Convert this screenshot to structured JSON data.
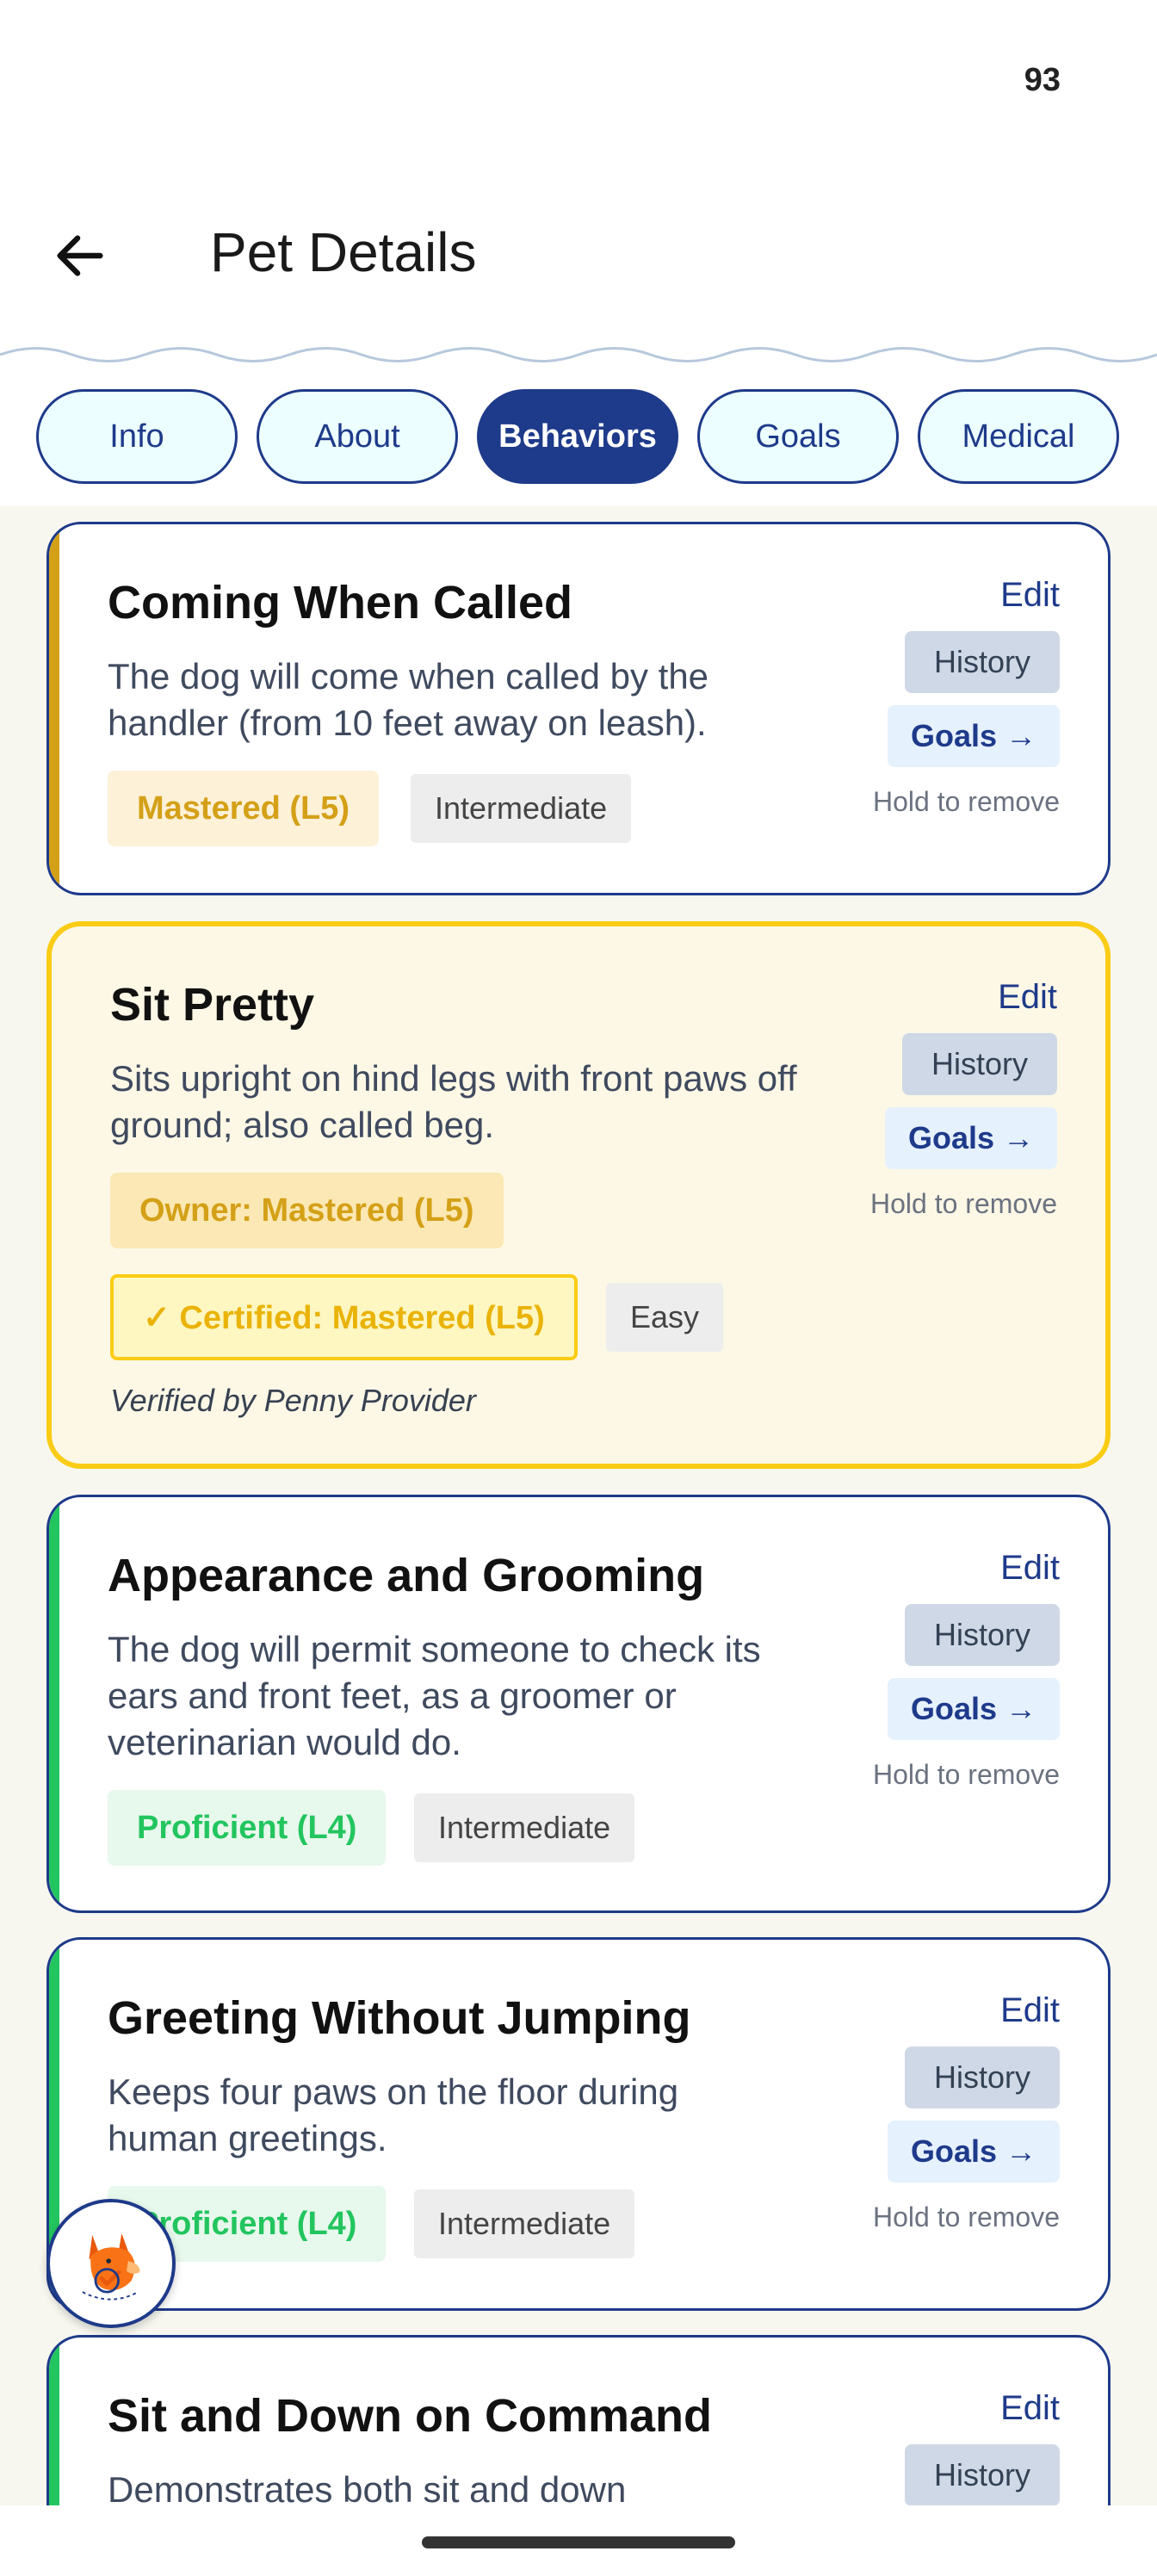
{
  "status": {
    "battery": "93"
  },
  "appbar": {
    "title": "Pet Details"
  },
  "tabs": [
    {
      "label": "Info"
    },
    {
      "label": "About"
    },
    {
      "label": "Behaviors"
    },
    {
      "label": "Goals"
    },
    {
      "label": "Medical"
    }
  ],
  "active_tab": "Behaviors",
  "actions": {
    "edit": "Edit",
    "history": "History",
    "goals": "Goals →",
    "hold": "Hold to remove"
  },
  "cards": [
    {
      "title": "Coming When Called",
      "description": "The dog will come when called by the handler (from 10 feet away on leash).",
      "status": "Mastered (L5)",
      "difficulty": "Intermediate",
      "accent_color": "#d4a017"
    },
    {
      "title": "Sit Pretty",
      "description": "Sits upright on hind legs with front paws off ground; also called beg.",
      "owner_status": "Owner: Mastered (L5)",
      "certified_status": "✓ Certified: Mastered (L5)",
      "difficulty": "Easy",
      "verified": "Verified by Penny Provider",
      "accent_color": "#facc15"
    },
    {
      "title": "Appearance and Grooming",
      "description": "The dog will permit someone to check its ears and front feet, as a groomer or veterinarian would do.",
      "status": "Proficient (L4)",
      "difficulty": "Intermediate",
      "accent_color": "#22c55e"
    },
    {
      "title": "Greeting Without Jumping",
      "description": "Keeps four paws on the floor during human greetings.",
      "status": "Proficient (L4)",
      "difficulty": "Intermediate",
      "accent_color": "#22c55e"
    },
    {
      "title": "Sit and Down on Command",
      "description": "Demonstrates both sit and down",
      "accent_color": "#22c55e"
    }
  ],
  "colors": {
    "primary": "#1e3a8a",
    "mastered_text": "#d4a017",
    "mastered_bg": "#fdf1d8",
    "proficient_text": "#22c55e",
    "proficient_bg": "#e7f8ec",
    "certified_border": "#facc15"
  },
  "icons": {
    "back": "arrow-left-icon",
    "fab": "dog-mascot-icon"
  }
}
